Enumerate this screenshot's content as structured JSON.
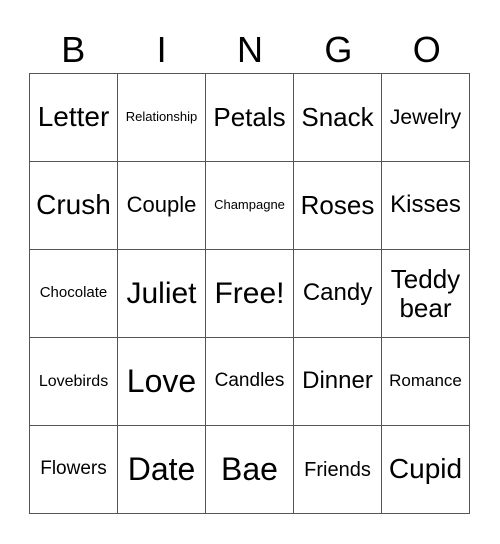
{
  "header": [
    "B",
    "I",
    "N",
    "G",
    "O"
  ],
  "rows": [
    [
      {
        "t": "Letter",
        "s": 28
      },
      {
        "t": "Relationship",
        "s": 13
      },
      {
        "t": "Petals",
        "s": 26
      },
      {
        "t": "Snack",
        "s": 26
      },
      {
        "t": "Jewelry",
        "s": 21
      }
    ],
    [
      {
        "t": "Crush",
        "s": 28
      },
      {
        "t": "Couple",
        "s": 22
      },
      {
        "t": "Champagne",
        "s": 13
      },
      {
        "t": "Roses",
        "s": 26
      },
      {
        "t": "Kisses",
        "s": 24
      }
    ],
    [
      {
        "t": "Chocolate",
        "s": 15
      },
      {
        "t": "Juliet",
        "s": 30
      },
      {
        "t": "Free!",
        "s": 30
      },
      {
        "t": "Candy",
        "s": 24
      },
      {
        "t": "Teddy bear",
        "s": 26
      }
    ],
    [
      {
        "t": "Lovebirds",
        "s": 16
      },
      {
        "t": "Love",
        "s": 32
      },
      {
        "t": "Candles",
        "s": 19
      },
      {
        "t": "Dinner",
        "s": 24
      },
      {
        "t": "Romance",
        "s": 17
      }
    ],
    [
      {
        "t": "Flowers",
        "s": 19
      },
      {
        "t": "Date",
        "s": 32
      },
      {
        "t": "Bae",
        "s": 32
      },
      {
        "t": "Friends",
        "s": 20
      },
      {
        "t": "Cupid",
        "s": 28
      }
    ]
  ]
}
